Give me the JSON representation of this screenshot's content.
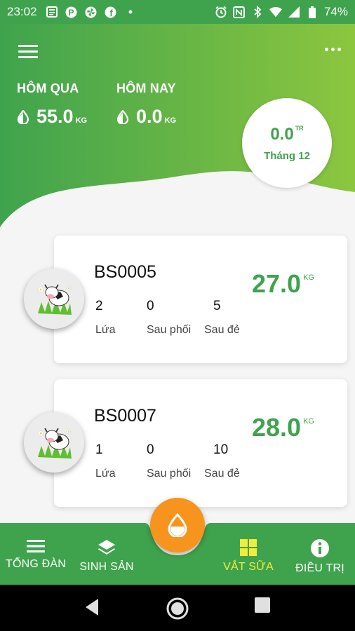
{
  "status_bar": {
    "time": "23:02",
    "battery": "74%",
    "icons_left": [
      "news-icon",
      "pinterest-icon",
      "pinwheel-icon",
      "facebook-icon",
      "dot-icon"
    ],
    "icons_right": [
      "alarm-icon",
      "nfc-icon",
      "bluetooth-icon",
      "wifi-icon",
      "signal-icon",
      "battery-icon"
    ]
  },
  "header": {
    "yesterday_label": "HÔM QUA",
    "yesterday_value": "55.0",
    "yesterday_unit": "KG",
    "today_label": "HÔM NAY",
    "today_value": "0.0",
    "today_unit": "KG",
    "month_value": "0.0",
    "month_unit": "TR",
    "month_label": "Tháng 12"
  },
  "cows": [
    {
      "id": "BS0005",
      "milk": "27.0",
      "milk_unit": "KG",
      "stats": [
        {
          "value": "2",
          "label": "Lứa"
        },
        {
          "value": "0",
          "label": "Sau phối"
        },
        {
          "value": "5",
          "label": "Sau đẻ"
        }
      ]
    },
    {
      "id": "BS0007",
      "milk": "28.0",
      "milk_unit": "KG",
      "stats": [
        {
          "value": "1",
          "label": "Lứa"
        },
        {
          "value": "0",
          "label": "Sau phối"
        },
        {
          "value": "10",
          "label": "Sau đẻ"
        }
      ]
    }
  ],
  "nav": {
    "herd": "TỔNG ĐÀN",
    "breeding": "SINH SẢN",
    "milking": "VẮT SỮA",
    "treatment": "ĐIỀU TRỊ",
    "active": "milking"
  },
  "colors": {
    "primary": "#3fa34d",
    "primary_light": "#8cc63f",
    "accent": "#f7941d",
    "active_nav": "#f4ec3a"
  }
}
